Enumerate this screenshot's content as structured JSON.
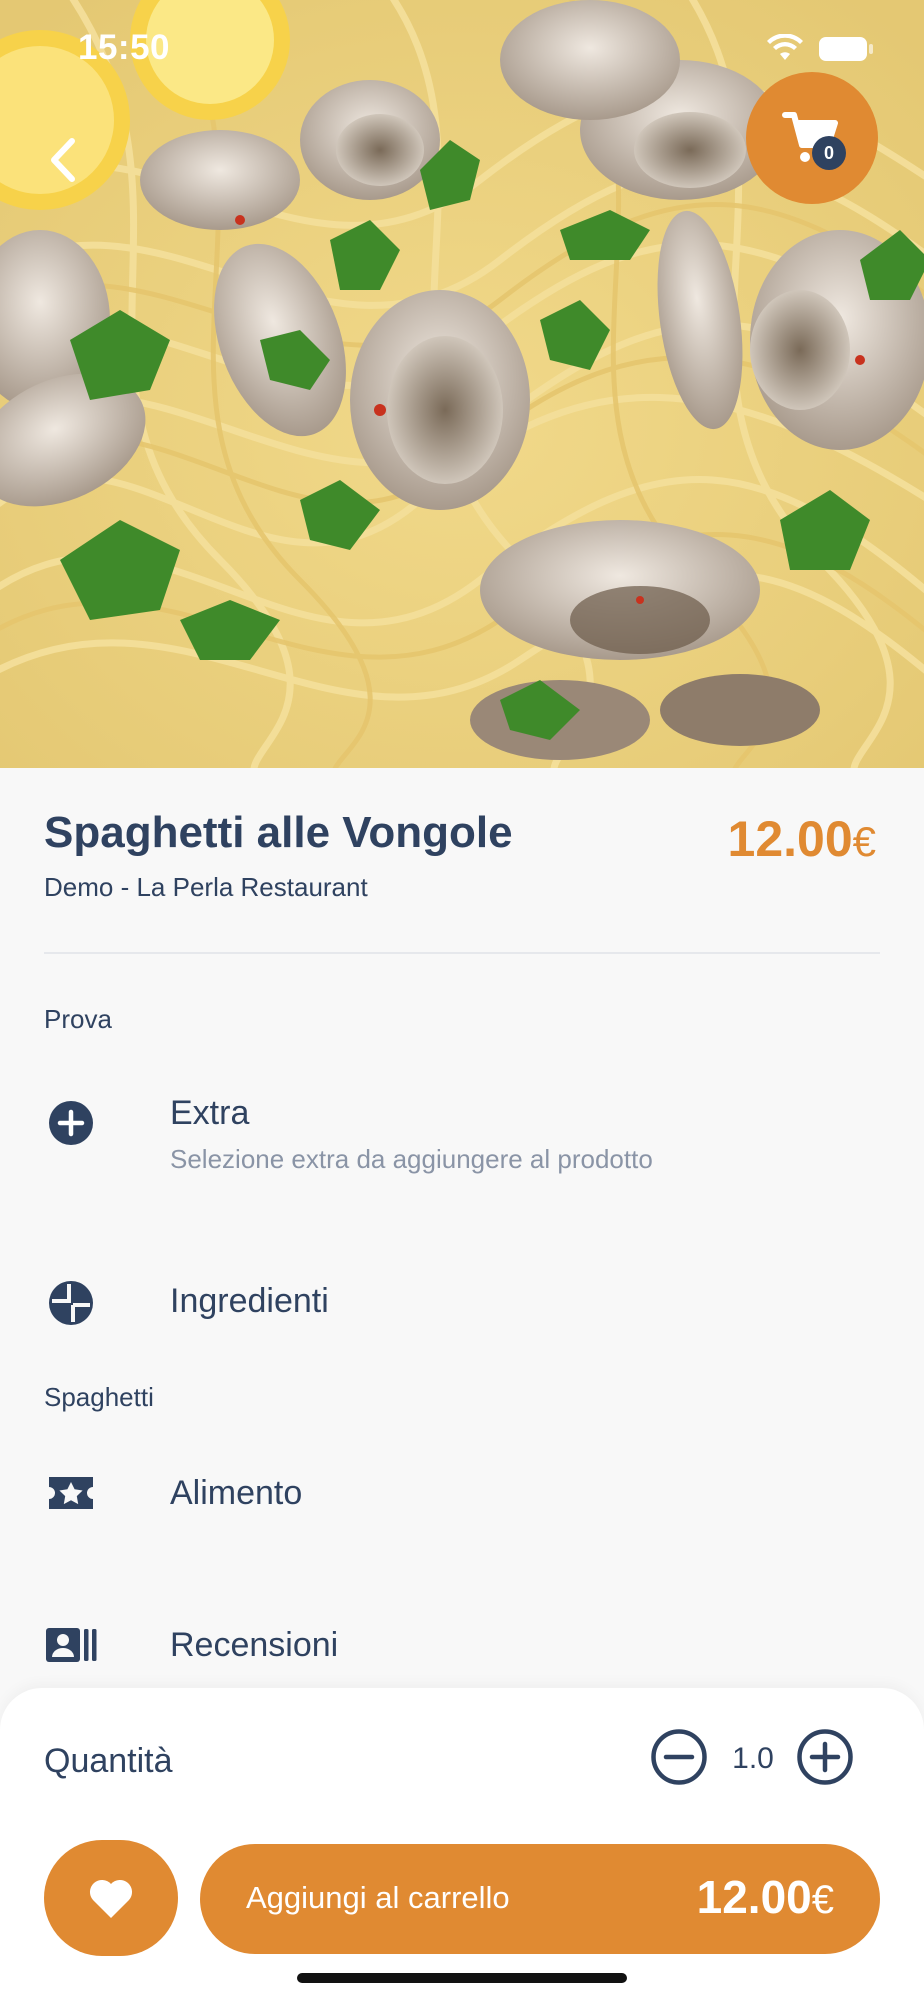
{
  "status_bar": {
    "time": "15:50"
  },
  "header": {
    "cart_count": "0",
    "back_icon": "chevron-left-icon",
    "cart_icon": "cart-icon"
  },
  "product": {
    "name": "Spaghetti alle Vongole",
    "price": "12.00",
    "currency": "€",
    "restaurant": "Demo - La Perla Restaurant"
  },
  "sections": [
    {
      "label": "Prova",
      "items": [
        {
          "icon": "plus-circle-icon",
          "title": "Extra",
          "subtitle": "Selezione extra da aggiungere al prodotto"
        },
        {
          "icon": "pie-chart-icon",
          "title": "Ingredienti"
        }
      ]
    },
    {
      "label": "Spaghetti",
      "items": [
        {
          "icon": "ticket-star-icon",
          "title": "Alimento"
        },
        {
          "icon": "id-card-icon",
          "title": "Recensioni"
        }
      ]
    }
  ],
  "bottom_sheet": {
    "quantity_label": "Quantità",
    "quantity": "1.0",
    "favorite_icon": "heart-icon",
    "add_button_label": "Aggiungi al carrello",
    "add_button_price": "12.00",
    "currency": "€"
  },
  "colors": {
    "accent": "#e08a32",
    "text_primary": "#2f4260",
    "text_secondary": "#8a94a6",
    "background": "#f8f8f8"
  }
}
